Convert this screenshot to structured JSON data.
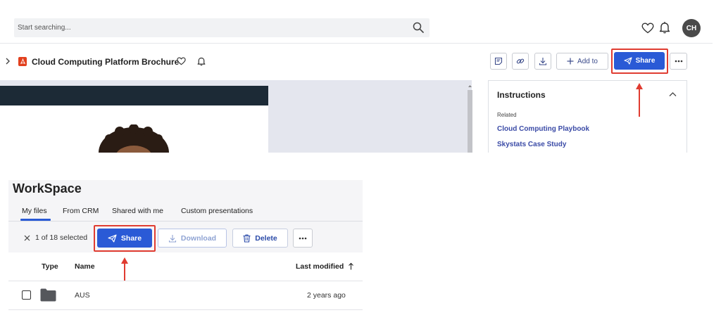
{
  "header": {
    "search_placeholder": "Start searching...",
    "search_icon": "search-icon",
    "favorites_icon": "heart-icon",
    "notifications_icon": "bell-icon",
    "avatar_initials": "CH"
  },
  "document": {
    "title": "Cloud Computing Platform Brochure",
    "file_icon": "pdf-icon"
  },
  "toolbar": {
    "add_to_label": "Add to",
    "share_label": "Share"
  },
  "side_panel": {
    "title": "Instructions",
    "related_label": "Related",
    "links": [
      "Cloud Computing Playbook",
      "Skystats Case Study"
    ]
  },
  "workspace": {
    "title": "WorkSpace",
    "tabs": [
      "My files",
      "From CRM",
      "Shared with me",
      "Custom presentations"
    ],
    "active_tab": "My files",
    "selection_text": "1 of 18 selected",
    "share_label": "Share",
    "download_label": "Download",
    "delete_label": "Delete",
    "columns": [
      "Type",
      "Name",
      "Last modified"
    ],
    "rows": [
      {
        "name": "AUS",
        "modified": "2 years ago"
      }
    ]
  },
  "colors": {
    "primary": "#2a5ad6",
    "highlight": "#e03c31",
    "link": "#3a4aa6"
  }
}
